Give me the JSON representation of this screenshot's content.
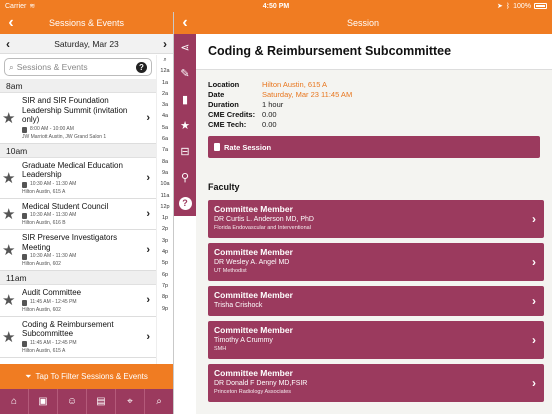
{
  "status": {
    "carrier": "Carrier",
    "wifi": "wifi-icon",
    "time": "4:50 PM",
    "battery_text": "100%",
    "location": "location-arrow-icon",
    "bluetooth": "bluetooth-icon"
  },
  "left_nav": {
    "title": "Sessions & Events",
    "back": "‹"
  },
  "right_nav": {
    "title": "Session",
    "back": "‹"
  },
  "date_bar": {
    "prev": "‹",
    "date": "Saturday, Mar 23",
    "next": "›"
  },
  "search": {
    "placeholder": "Sessions & Events",
    "help": "?"
  },
  "schedule": [
    {
      "hour": "8am",
      "items": [
        {
          "title": "SIR and SIR Foundation Leadership Summit (invitation only)",
          "time": "8:00 AM - 10:00 AM",
          "location": "JW Marriott Austin, JW Grand Salon 1"
        }
      ]
    },
    {
      "hour": "10am",
      "items": [
        {
          "title": "Graduate Medical Education Leadership",
          "time": "10:30 AM - 11:30 AM",
          "location": "Hilton Austin, 615 A"
        },
        {
          "title": "Medical Student Council",
          "time": "10:30 AM - 11:30 AM",
          "location": "Hilton Austin, 616 B"
        },
        {
          "title": "SIR Preserve Investigators Meeting",
          "time": "10:30 AM - 11:30 AM",
          "location": "Hilton Austin, 602"
        }
      ]
    },
    {
      "hour": "11am",
      "items": [
        {
          "title": "Audit Committee",
          "time": "11:45 AM - 12:45 PM",
          "location": "Hilton Austin, 602"
        },
        {
          "title": "Coding & Reimbursement Subcommittee",
          "time": "11:45 AM - 12:45 PM",
          "location": "Hilton Austin, 615 A"
        }
      ]
    }
  ],
  "index_letters": [
    "12a",
    "1a",
    "2a",
    "3a",
    "4a",
    "5a",
    "6a",
    "7a",
    "8a",
    "9a",
    "10a",
    "11a",
    "12p",
    "1p",
    "2p",
    "3p",
    "4p",
    "5p",
    "6p",
    "7p",
    "8p",
    "9p"
  ],
  "filter_label": "Tap To Filter Sessions & Events",
  "session": {
    "title": "Coding & Reimbursement Subcommittee",
    "details": [
      {
        "label": "Location",
        "value": "Hilton Austin, 615 A",
        "link": true
      },
      {
        "label": "Date",
        "value": "Saturday, Mar 23 11:45 AM",
        "link": true
      },
      {
        "label": "Duration",
        "value": "1 hour",
        "link": false
      },
      {
        "label": "CME Credits:",
        "value": "0.00",
        "link": false
      },
      {
        "label": "CME Tech:",
        "value": "0.00",
        "link": false
      }
    ],
    "rate_label": "Rate Session",
    "faculty_heading": "Faculty",
    "faculty": [
      {
        "role": "Committee Member",
        "name": "DR Curtis L. Anderson MD, PhD",
        "org": "Florida Endovascular and Interventional"
      },
      {
        "role": "Committee Member",
        "name": "DR Wesley A. Angel MD",
        "org": "UT Methodist"
      },
      {
        "role": "Committee Member",
        "name": "Trisha Crishock",
        "org": ""
      },
      {
        "role": "Committee Member",
        "name": "Timothy A Crummy",
        "org": "SMH"
      },
      {
        "role": "Committee Member",
        "name": "DR Donald F Denny MD,FSIR",
        "org": "Princeton Radiology Associates"
      }
    ]
  },
  "colors": {
    "orange": "#f07c22",
    "plum": "#9b3a5e"
  }
}
